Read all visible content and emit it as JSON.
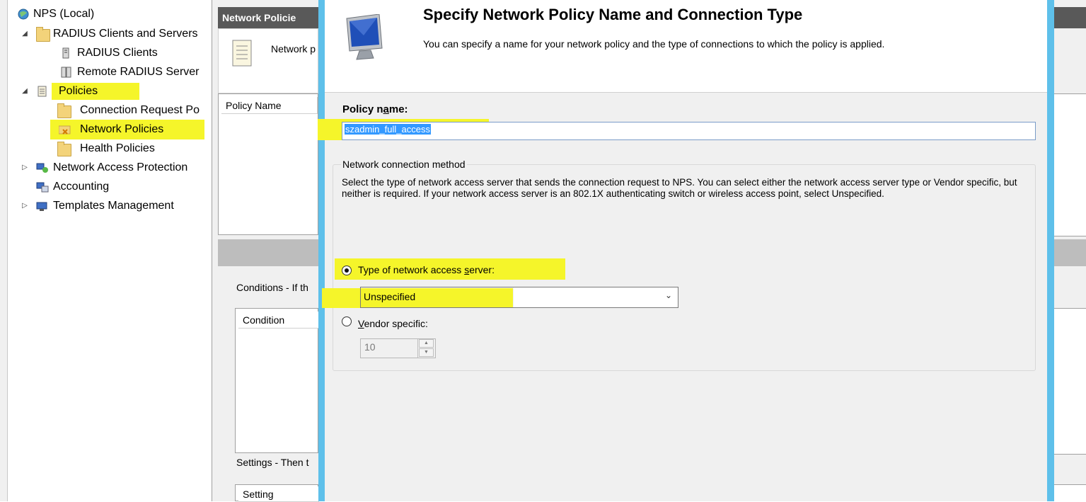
{
  "tree": {
    "root": "NPS (Local)",
    "items": [
      {
        "label": "RADIUS Clients and Servers",
        "icon": "folder-icon"
      },
      {
        "label": "RADIUS Clients",
        "icon": "server-icon"
      },
      {
        "label": "Remote RADIUS Server",
        "icon": "server-group-icon"
      },
      {
        "label": "Policies",
        "icon": "policy-icon"
      },
      {
        "label": "Connection Request Po",
        "icon": "folder-icon"
      },
      {
        "label": "Network Policies",
        "icon": "network-policy-icon"
      },
      {
        "label": "Health Policies",
        "icon": "folder-icon"
      },
      {
        "label": "Network Access Protection",
        "icon": "nap-icon"
      },
      {
        "label": "Accounting",
        "icon": "accounting-icon"
      },
      {
        "label": "Templates Management",
        "icon": "templates-icon"
      }
    ]
  },
  "middle": {
    "header": "Network Policie",
    "info_text": "Network p",
    "list_column": "Policy Name",
    "conditions_label": "Conditions - If th",
    "condition_column": "Condition",
    "settings_label": "Settings - Then t",
    "setting_column": "Setting"
  },
  "dialog": {
    "title": "Specify Network Policy Name and Connection Type",
    "subtitle": "You can specify a name for your network policy and the type of connections to which the policy is applied.",
    "policy_name_label_pre": "Policy n",
    "policy_name_label_accel": "a",
    "policy_name_label_post": "me:",
    "policy_name_value": "szadmin_full_access",
    "group_label": "Network connection method",
    "group_desc": "Select the type of network access server that sends the connection request to NPS. You can select either the network access server type or Vendor specific, but neither is required.  If your network access server is an 802.1X authenticating switch or wireless access point, select Unspecified.",
    "type_label_pre": "Type of network access ",
    "type_label_accel": "s",
    "type_label_post": "erver:",
    "type_value": "Unspecified",
    "vendor_label_accel": "V",
    "vendor_label_post": "endor specific:",
    "vendor_value": "10"
  },
  "colors": {
    "highlight": "#f5f52a",
    "dialog_frame": "#5ec0ea",
    "header_bar": "#595959"
  }
}
